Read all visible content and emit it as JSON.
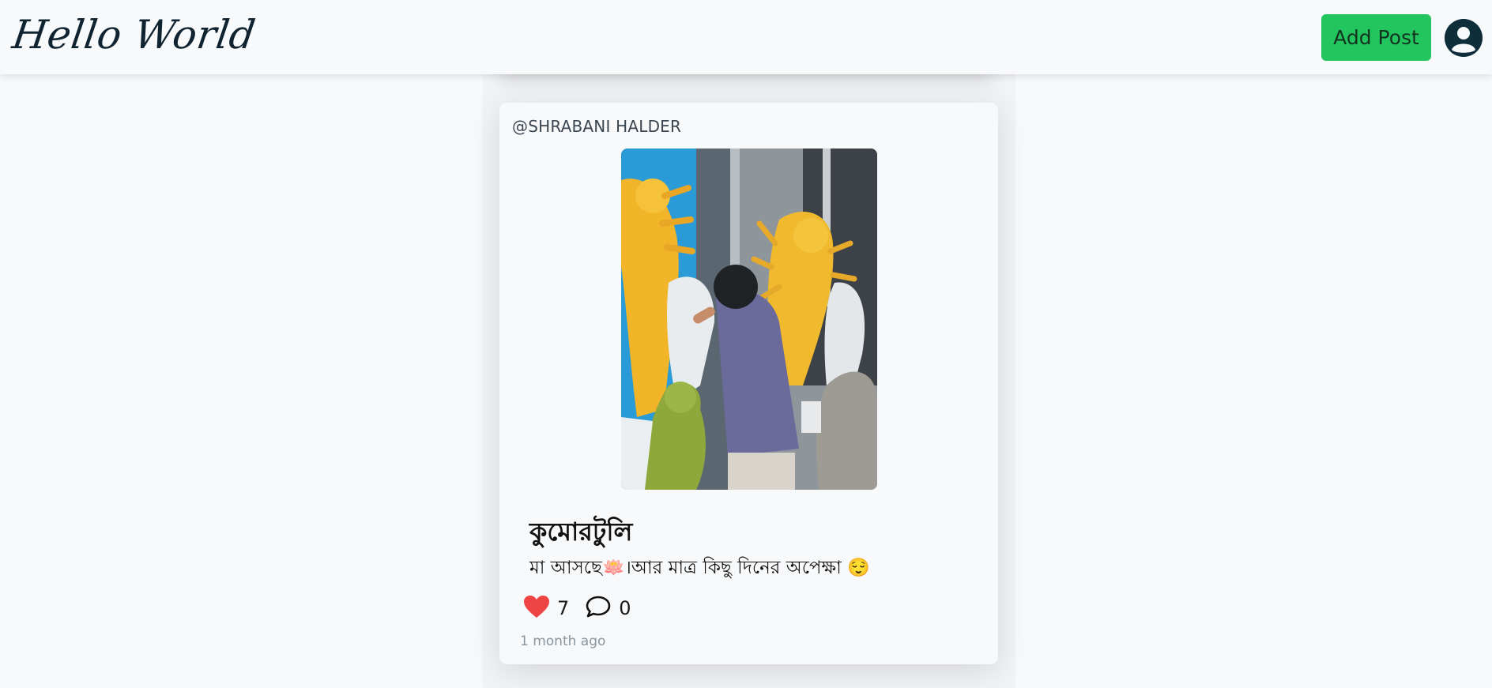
{
  "header": {
    "logo_text": "Hello World",
    "add_post_label": "Add Post",
    "profile_icon": "user-circle-icon"
  },
  "post": {
    "author": "@SHRABANI HALDER",
    "image_alt": "Idol maker painting Durga idols in a workshop",
    "title": "কুমোরটুলি",
    "description": "মা আসছে🪷।আর মাত্র কিছু দিনের অপেক্ষা 😌",
    "likes": "7",
    "comments": "0",
    "timestamp": "1 month ago",
    "like_icon": "heart-icon",
    "comment_icon": "speech-bubble-icon"
  },
  "colors": {
    "accent_button": "#22c55e",
    "like_heart": "#ef4444",
    "profile_circle": "#0f2e3c",
    "background": "#f7f9fb"
  }
}
